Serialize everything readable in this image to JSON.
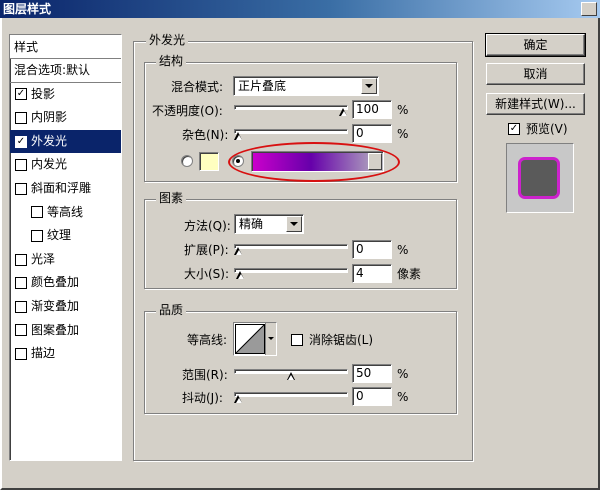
{
  "window": {
    "title": "图层样式"
  },
  "sidebar": {
    "header": "样式",
    "blend_options": "混合选项:默认",
    "items": [
      {
        "label": "投影",
        "checked": true,
        "selected": false,
        "sub": false
      },
      {
        "label": "内阴影",
        "checked": false,
        "selected": false,
        "sub": false
      },
      {
        "label": "外发光",
        "checked": true,
        "selected": true,
        "sub": false
      },
      {
        "label": "内发光",
        "checked": false,
        "selected": false,
        "sub": false
      },
      {
        "label": "斜面和浮雕",
        "checked": false,
        "selected": false,
        "sub": false
      },
      {
        "label": "等高线",
        "checked": false,
        "selected": false,
        "sub": true
      },
      {
        "label": "纹理",
        "checked": false,
        "selected": false,
        "sub": true
      },
      {
        "label": "光泽",
        "checked": false,
        "selected": false,
        "sub": false
      },
      {
        "label": "颜色叠加",
        "checked": false,
        "selected": false,
        "sub": false
      },
      {
        "label": "渐变叠加",
        "checked": false,
        "selected": false,
        "sub": false
      },
      {
        "label": "图案叠加",
        "checked": false,
        "selected": false,
        "sub": false
      },
      {
        "label": "描边",
        "checked": false,
        "selected": false,
        "sub": false
      }
    ]
  },
  "outer_glow": {
    "title": "外发光",
    "structure": {
      "title": "结构",
      "blend_mode_label": "混合模式:",
      "blend_mode_value": "正片叠底",
      "opacity_label": "不透明度(O):",
      "opacity_value": "100",
      "opacity_unit": "%",
      "opacity_level": 1.0,
      "noise_label": "杂色(N):",
      "noise_value": "0",
      "noise_unit": "%",
      "noise_level": 0.0,
      "swatch_color": "#ffffc0",
      "gradient_from": "#cc00cc",
      "gradient_to": "#b8b8c0",
      "highlight_color": "#d81010"
    },
    "elements": {
      "title": "图素",
      "method_label": "方法(Q):",
      "method_value": "精确",
      "spread_label": "扩展(P):",
      "spread_value": "0",
      "spread_unit": "%",
      "spread_level": 0.0,
      "size_label": "大小(S):",
      "size_value": "4",
      "size_unit": "像素",
      "size_level": 0.02
    },
    "quality": {
      "title": "品质",
      "contour_label": "等高线:",
      "antialias_label": "消除锯齿(L)",
      "antialias_checked": false,
      "range_label": "范围(R):",
      "range_value": "50",
      "range_unit": "%",
      "range_level": 0.5,
      "jitter_label": "抖动(J):",
      "jitter_value": "0",
      "jitter_unit": "%",
      "jitter_level": 0.0
    }
  },
  "buttons": {
    "ok": "确定",
    "cancel": "取消",
    "new_style": "新建样式(W)...",
    "preview_label": "预览(V)",
    "preview_checked": true
  },
  "preview": {
    "fill": "#5a5a5a",
    "glow": "#cc22cc"
  }
}
